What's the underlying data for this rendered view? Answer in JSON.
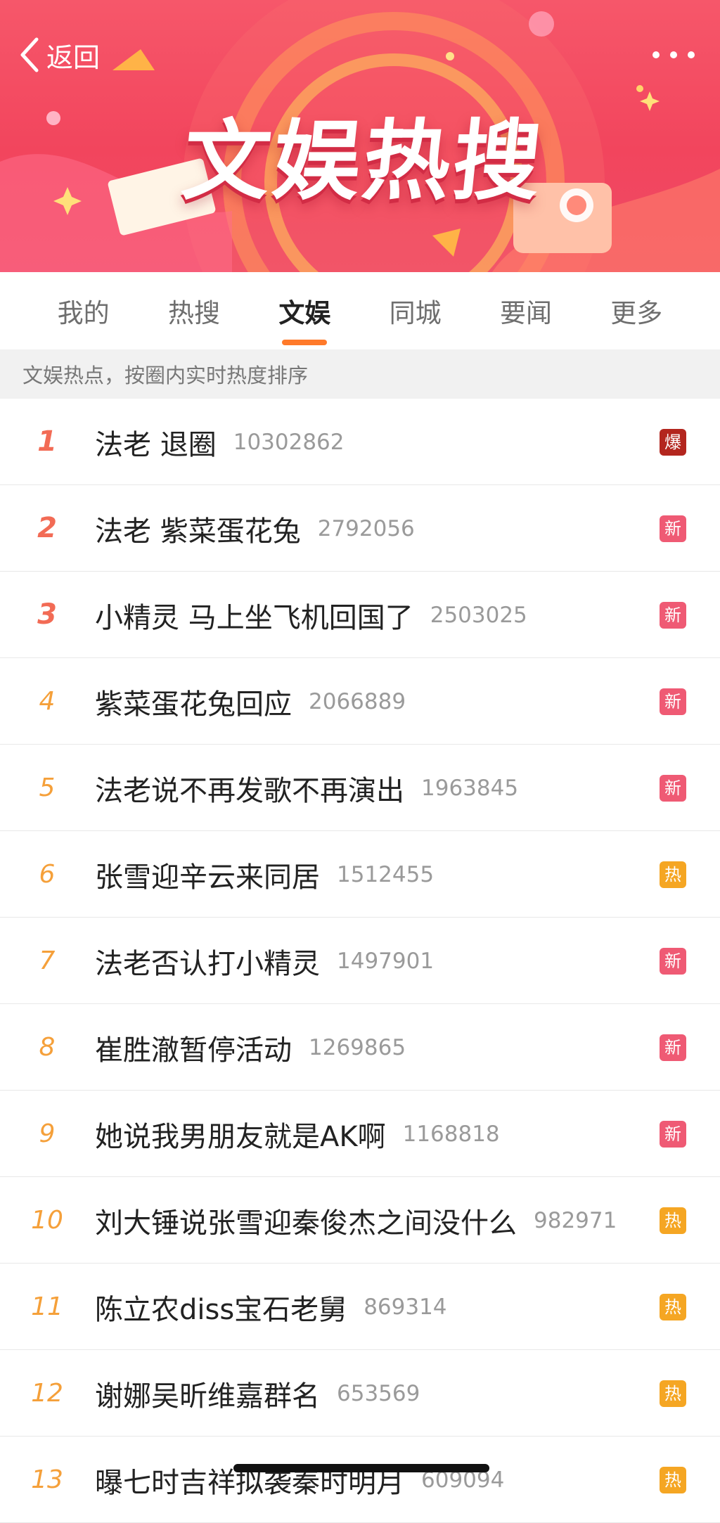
{
  "header": {
    "back_label": "返回",
    "title": "文娱热搜"
  },
  "tabs": [
    {
      "label": "我的",
      "active": false
    },
    {
      "label": "热搜",
      "active": false
    },
    {
      "label": "文娱",
      "active": true
    },
    {
      "label": "同城",
      "active": false
    },
    {
      "label": "要闻",
      "active": false
    },
    {
      "label": "更多",
      "active": false
    }
  ],
  "subheader": "文娱热点，按圈内实时热度排序",
  "badge_colors": {
    "爆": "#b3261e",
    "新": "#ef5a74",
    "热": "#f5a623"
  },
  "colors": {
    "accent": "#ff7a2a",
    "rank_top": "#f26b55",
    "rank_other": "#f5a03a",
    "banner": "#f2455d"
  },
  "items": [
    {
      "rank": "1",
      "title": "法老 退圈",
      "heat": "10302862",
      "badge": "爆"
    },
    {
      "rank": "2",
      "title": "法老 紫菜蛋花兔",
      "heat": "2792056",
      "badge": "新"
    },
    {
      "rank": "3",
      "title": "小精灵 马上坐飞机回国了",
      "heat": "2503025",
      "badge": "新"
    },
    {
      "rank": "4",
      "title": "紫菜蛋花兔回应",
      "heat": "2066889",
      "badge": "新"
    },
    {
      "rank": "5",
      "title": "法老说不再发歌不再演出",
      "heat": "1963845",
      "badge": "新"
    },
    {
      "rank": "6",
      "title": "张雪迎辛云来同居",
      "heat": "1512455",
      "badge": "热"
    },
    {
      "rank": "7",
      "title": "法老否认打小精灵",
      "heat": "1497901",
      "badge": "新"
    },
    {
      "rank": "8",
      "title": "崔胜澈暂停活动",
      "heat": "1269865",
      "badge": "新"
    },
    {
      "rank": "9",
      "title": "她说我男朋友就是AK啊",
      "heat": "1168818",
      "badge": "新"
    },
    {
      "rank": "10",
      "title": "刘大锤说张雪迎秦俊杰之间没什么",
      "heat": "982971",
      "badge": "热"
    },
    {
      "rank": "11",
      "title": "陈立农diss宝石老舅",
      "heat": "869314",
      "badge": "热"
    },
    {
      "rank": "12",
      "title": "谢娜吴昕维嘉群名",
      "heat": "653569",
      "badge": "热"
    },
    {
      "rank": "13",
      "title": "曝七时吉祥拟袭秦时明月",
      "heat": "609094",
      "badge": "热"
    }
  ]
}
